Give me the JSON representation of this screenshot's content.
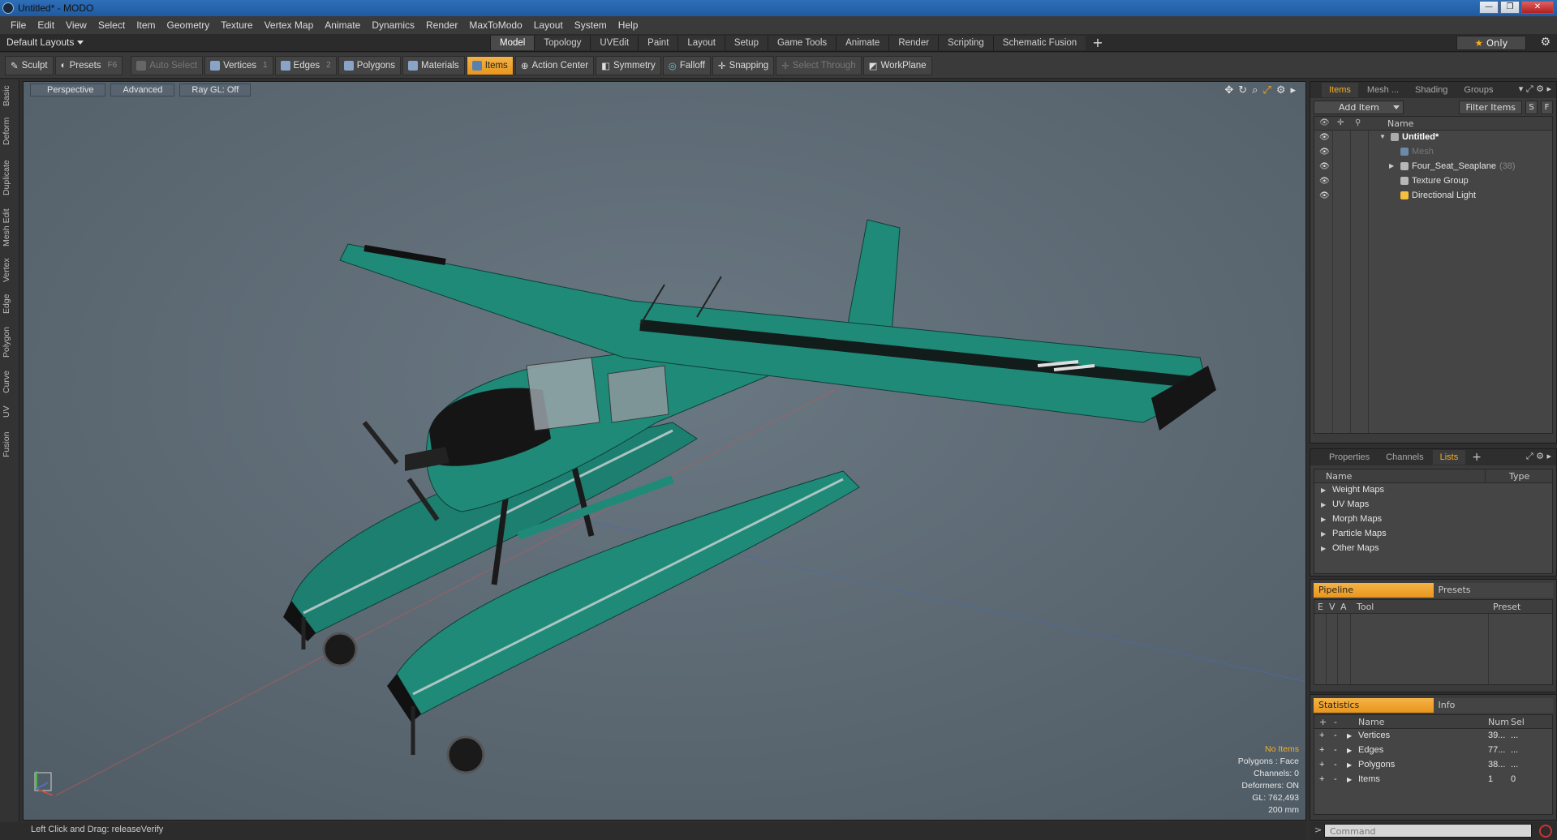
{
  "window": {
    "title": "Untitled* - MODO",
    "buttons": [
      "—",
      "❐",
      "✕"
    ]
  },
  "menu": [
    "File",
    "Edit",
    "View",
    "Select",
    "Item",
    "Geometry",
    "Texture",
    "Vertex Map",
    "Animate",
    "Dynamics",
    "Render",
    "MaxToModo",
    "Layout",
    "System",
    "Help"
  ],
  "layout_tabs": {
    "layout_selector": "Default Layouts",
    "tabs": [
      "Model",
      "Topology",
      "UVEdit",
      "Paint",
      "Layout",
      "Setup",
      "Game Tools",
      "Animate",
      "Render",
      "Scripting",
      "Schematic Fusion"
    ],
    "active_tab": "Model",
    "add": "+",
    "only_label": "Only"
  },
  "toolbar": {
    "sculpt": "Sculpt",
    "presets": "Presets",
    "presets_key": "F6",
    "auto_select": "Auto Select",
    "vertices": "Vertices",
    "vertices_key": "1",
    "edges": "Edges",
    "edges_key": "2",
    "polygons": "Polygons",
    "materials": "Materials",
    "items": "Items",
    "action_center": "Action Center",
    "symmetry": "Symmetry",
    "falloff": "Falloff",
    "snapping": "Snapping",
    "select_through": "Select Through",
    "workplane": "WorkPlane"
  },
  "left_tabs": [
    "Basic",
    "Deform",
    "Duplicate",
    "Mesh Edit",
    "Vertex",
    "Edge",
    "Polygon",
    "Curve",
    "UV",
    "Fusion"
  ],
  "viewport": {
    "view_mode": "Perspective",
    "advanced": "Advanced",
    "raygl": "Ray GL: Off",
    "info": {
      "no_items": "No Items",
      "polygons": "Polygons : Face",
      "channels": "Channels: 0",
      "deformers": "Deformers: ON",
      "gl": "GL: 762,493",
      "scale": "200 mm"
    }
  },
  "statusbar": {
    "text": "Left Click and Drag:   releaseVerify"
  },
  "items_panel": {
    "tabs": [
      "Items",
      "Mesh ...",
      "Shading",
      "Groups"
    ],
    "active_tab": "Items",
    "add_item": "Add Item",
    "filter_items": "Filter Items",
    "s_btn": "S",
    "f_btn": "F",
    "column_name": "Name",
    "tree": [
      {
        "label": "Untitled*",
        "indent": 0,
        "bold": true
      },
      {
        "label": "Mesh",
        "indent": 1,
        "dim": true
      },
      {
        "label": "Four_Seat_Seaplane",
        "count": "(38)",
        "indent": 1,
        "expandable": true
      },
      {
        "label": "Texture Group",
        "indent": 1
      },
      {
        "label": "Directional Light",
        "indent": 1
      }
    ]
  },
  "lists_panel": {
    "tabs": [
      "Properties",
      "Channels",
      "Lists"
    ],
    "active_tab": "Lists",
    "col_name": "Name",
    "col_type": "Type",
    "rows": [
      "Weight Maps",
      "UV Maps",
      "Morph Maps",
      "Particle Maps",
      "Other Maps"
    ]
  },
  "pipeline_panel": {
    "tabs": [
      "Pipeline",
      "Presets"
    ],
    "cols": [
      "E",
      "V",
      "A",
      "Tool",
      "Preset"
    ]
  },
  "stats_panel": {
    "tabs": [
      "Statistics",
      "Info"
    ],
    "cols": [
      "+",
      "-",
      "Name",
      "Num",
      "Sel"
    ],
    "rows": [
      {
        "name": "Vertices",
        "num": "39...",
        "sel": "..."
      },
      {
        "name": "Edges",
        "num": "77...",
        "sel": "..."
      },
      {
        "name": "Polygons",
        "num": "38...",
        "sel": "..."
      },
      {
        "name": "Items",
        "num": "1",
        "sel": "0"
      }
    ]
  },
  "command": {
    "prompt": ">",
    "placeholder": "Command"
  },
  "colors": {
    "accent": "#f4b020",
    "plane_body": "#1f8a78",
    "viewport_bg": "#5d6b75"
  }
}
